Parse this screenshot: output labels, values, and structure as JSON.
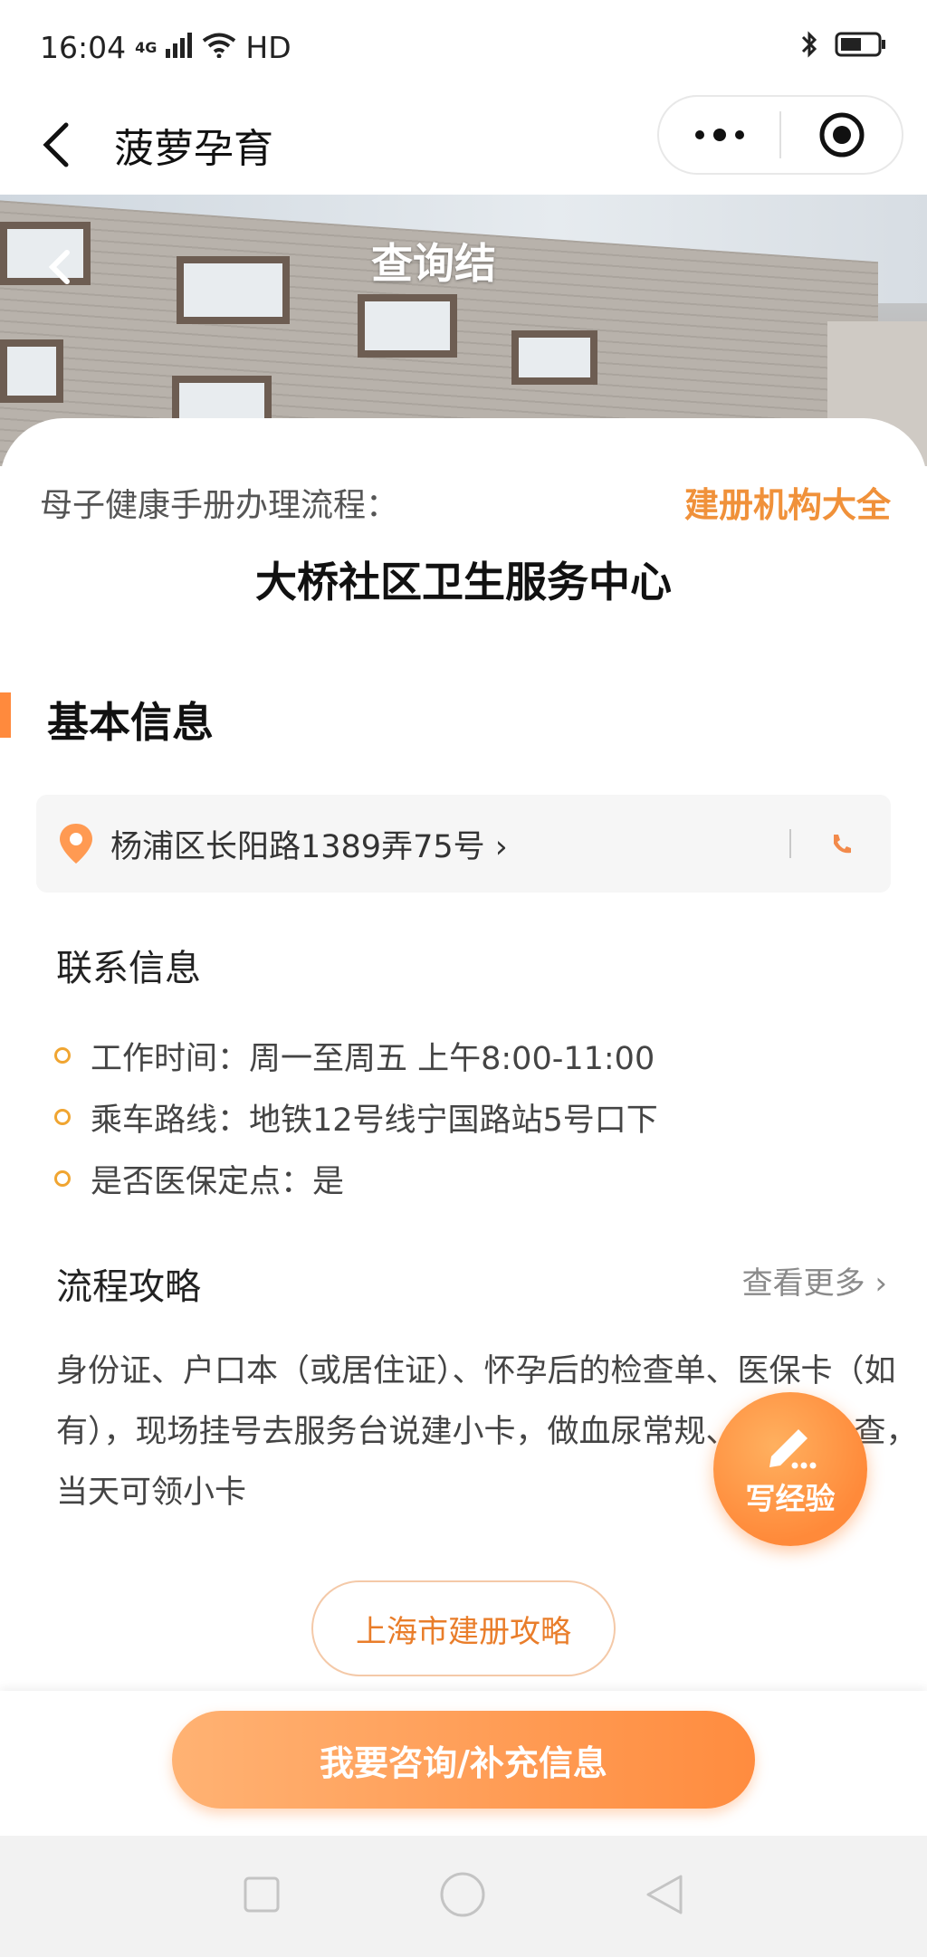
{
  "status_bar": {
    "time": "16:04",
    "network": "4G",
    "signal_icon": "signal-icon",
    "wifi_icon": "wifi-icon",
    "hd": "HD",
    "bluetooth_icon": "bluetooth-icon",
    "battery_icon": "battery-icon"
  },
  "nav": {
    "title": "菠萝孕育",
    "back_icon": "back-arrow-icon",
    "more_icon": "more-dots-icon",
    "close_icon": "target-icon"
  },
  "hero": {
    "title": "查询结",
    "back_icon": "back-arrow-icon"
  },
  "header": {
    "flow_label": "母子健康手册办理流程：",
    "directory_link": "建册机构大全",
    "org_name": "大桥社区卫生服务中心"
  },
  "basic_info": {
    "section_title": "基本信息",
    "address": "杨浦区长阳路1389弄75号 ›",
    "contact_title": "联系信息",
    "items": [
      "工作时间：周一至周五 上午8:00-11:00",
      "乘车路线：地铁12号线宁国路站5号口下",
      "是否医保定点：是"
    ]
  },
  "strategy": {
    "title": "流程攻略",
    "more": "查看更多 ›",
    "text": "身份证、户口本（或居住证）、怀孕后的检查单、医保卡（如有），现场挂号去服务台说建小卡，做血尿常规、B超等检查，当天可领小卡"
  },
  "buttons": {
    "city_guide": "上海市建册攻略",
    "write_experience": "写经验",
    "consult": "我要咨询/补充信息"
  },
  "colors": {
    "accent": "#ff8a3d",
    "link": "#f0913a"
  }
}
